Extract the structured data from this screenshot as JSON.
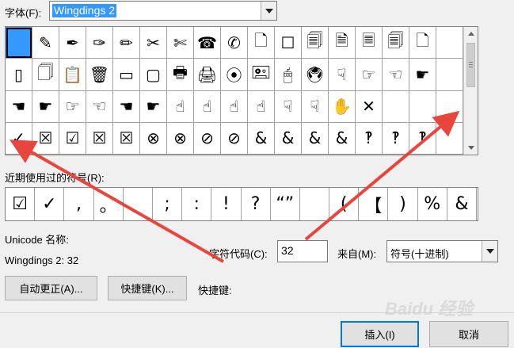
{
  "font": {
    "label": "字体(F):",
    "value": "Wingdings 2"
  },
  "grid": {
    "rows": [
      [
        " ",
        "✎",
        "✒",
        "✑",
        "✏",
        "✂",
        "✄",
        "☎",
        "✆",
        "🗋",
        "☐",
        "🗐",
        "🗎",
        "🗏",
        "🗐",
        "🗋",
        ""
      ],
      [
        "▯",
        "🗍",
        "📋",
        "🗑",
        "▭",
        "▢",
        "🖶",
        "🖨",
        "⦿",
        "🖭",
        "🖱",
        "🖲",
        "☟",
        "☞",
        "☜",
        "☛",
        ""
      ],
      [
        "☚",
        "☛",
        "☞",
        "☜",
        "☚",
        "☛",
        "☝",
        "☝",
        "☝",
        "☝",
        "☟",
        "☟",
        "✋",
        "✕",
        "",
        "",
        ""
      ],
      [
        "✓",
        "☒",
        "☑",
        "☒",
        "☒",
        "⊗",
        "⊗",
        "⊘",
        "⊘",
        "&",
        "&",
        "&",
        "&",
        "‽",
        "‽",
        "‽",
        ""
      ]
    ],
    "selected_index": 0
  },
  "recent": {
    "label": "近期使用过的符号(R):",
    "symbols": [
      "☑",
      "✓",
      ",",
      "。",
      "、",
      ";",
      ":",
      "!",
      "?",
      "“”",
      "",
      "(",
      "【",
      ")",
      "%",
      "&"
    ]
  },
  "unicode_name_label": "Unicode 名称:",
  "unicode_name_value": "Wingdings 2: 32",
  "char_code": {
    "label": "字符代码(C):",
    "value": "32"
  },
  "from": {
    "label": "来自(M):",
    "value": "符号(十进制)"
  },
  "buttons": {
    "autocorrect": "自动更正(A)...",
    "shortcut_key": "快捷键(K)...",
    "insert": "插入(I)",
    "cancel": "取消"
  },
  "shortcut_label": "快捷键:",
  "watermark": "Baidu 经验",
  "annotation": {
    "arrow_color": "#e8453c"
  },
  "colors": {
    "selection": "#3399ff",
    "focus": "#0078d7"
  }
}
